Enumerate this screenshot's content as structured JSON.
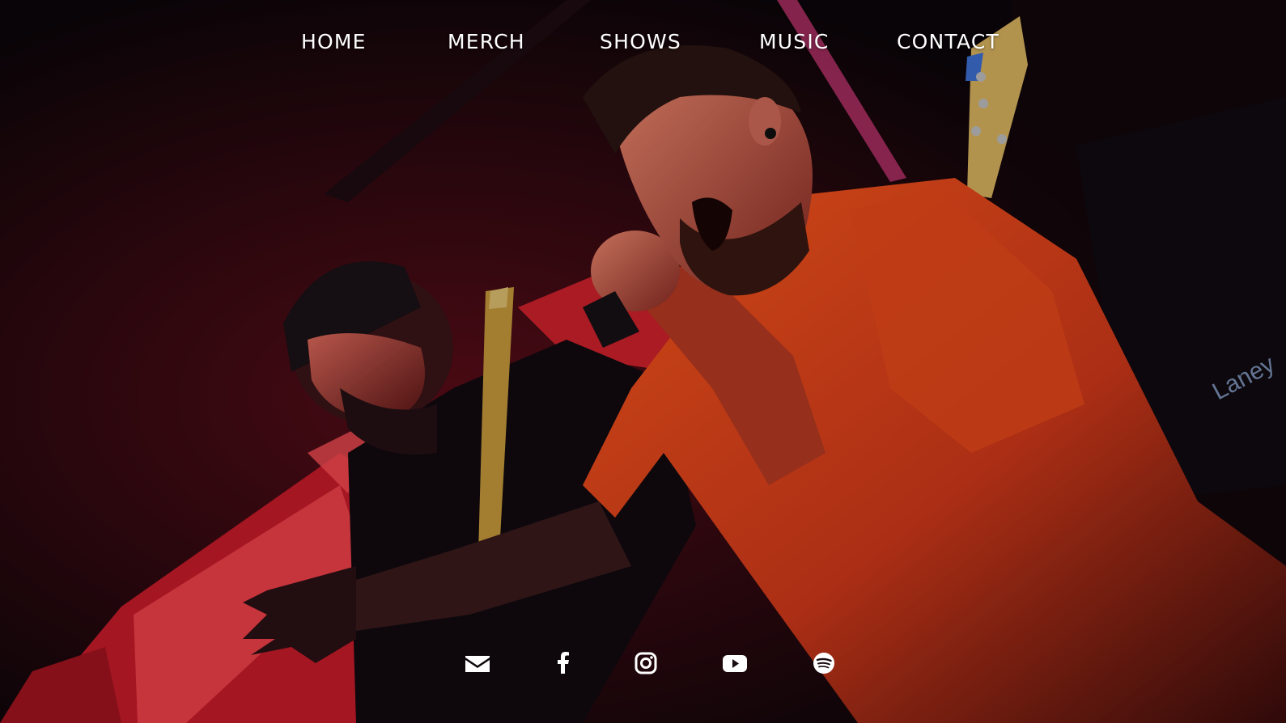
{
  "nav": {
    "items": [
      {
        "label": "HOME"
      },
      {
        "label": "MERCH"
      },
      {
        "label": "SHOWS"
      },
      {
        "label": "MUSIC"
      },
      {
        "label": "CONTACT"
      }
    ]
  },
  "hero": {
    "image": "live band photo: screaming vocalist in orange shirt with microphone, guitarist in cap behind, red stage lighting",
    "amp_text": "Laney"
  },
  "social": {
    "icons": [
      "envelope-icon",
      "facebook-icon",
      "instagram-icon",
      "youtube-icon",
      "spotify-icon"
    ]
  },
  "colors": {
    "nav_text": "#ffffff",
    "background": "#0c0609",
    "stage_red": "#e0232f",
    "shirt_orange": "#e8481a"
  }
}
